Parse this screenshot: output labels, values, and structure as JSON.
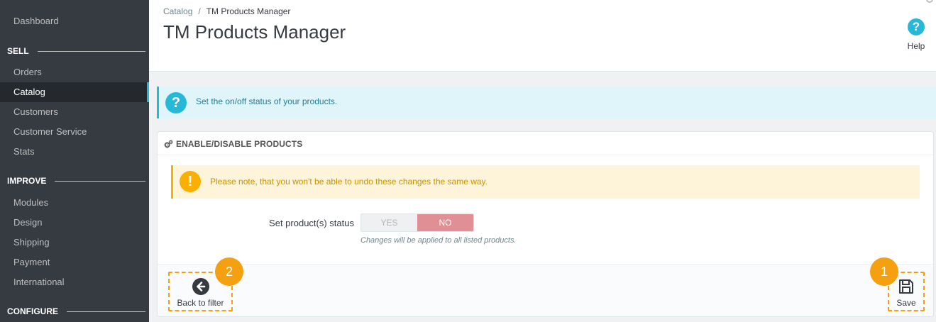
{
  "sidebar": {
    "items": [
      {
        "label": "Dashboard"
      },
      {
        "section": "SELL"
      },
      {
        "label": "Orders"
      },
      {
        "label": "Catalog",
        "active": true
      },
      {
        "label": "Customers"
      },
      {
        "label": "Customer Service"
      },
      {
        "label": "Stats"
      },
      {
        "section": "IMPROVE"
      },
      {
        "label": "Modules"
      },
      {
        "label": "Design"
      },
      {
        "label": "Shipping"
      },
      {
        "label": "Payment"
      },
      {
        "label": "International"
      },
      {
        "section": "CONFIGURE"
      }
    ]
  },
  "header": {
    "breadcrumb": {
      "parent": "Catalog",
      "separator": "/",
      "current": "TM Products Manager"
    },
    "title": "TM Products Manager",
    "help": {
      "icon": "question-circle-icon",
      "label": "Help"
    }
  },
  "info_alert": {
    "icon": "question-circle-icon",
    "text": "Set the on/off status of your products."
  },
  "panel": {
    "icon": "cogs-icon",
    "title": "ENABLE/DISABLE PRODUCTS",
    "warning": {
      "icon": "exclamation-circle-icon",
      "text": "Please note, that you won't be able to undo these changes the same way."
    },
    "form": {
      "label": "Set product(s) status",
      "switch": {
        "yes": "YES",
        "no": "NO",
        "selected": "NO"
      },
      "help": "Changes will be applied to all listed products."
    },
    "footer": {
      "back": {
        "icon": "arrow-circle-left-icon",
        "label": "Back to filter",
        "badge": "2"
      },
      "save": {
        "icon": "floppy-disk-icon",
        "label": "Save",
        "badge": "1"
      }
    }
  },
  "colors": {
    "sidebar_bg": "#363a41",
    "accent": "#25b9d7",
    "warning": "#fab000",
    "switch_no": "#e08f95",
    "annotation": "#f4a011"
  }
}
